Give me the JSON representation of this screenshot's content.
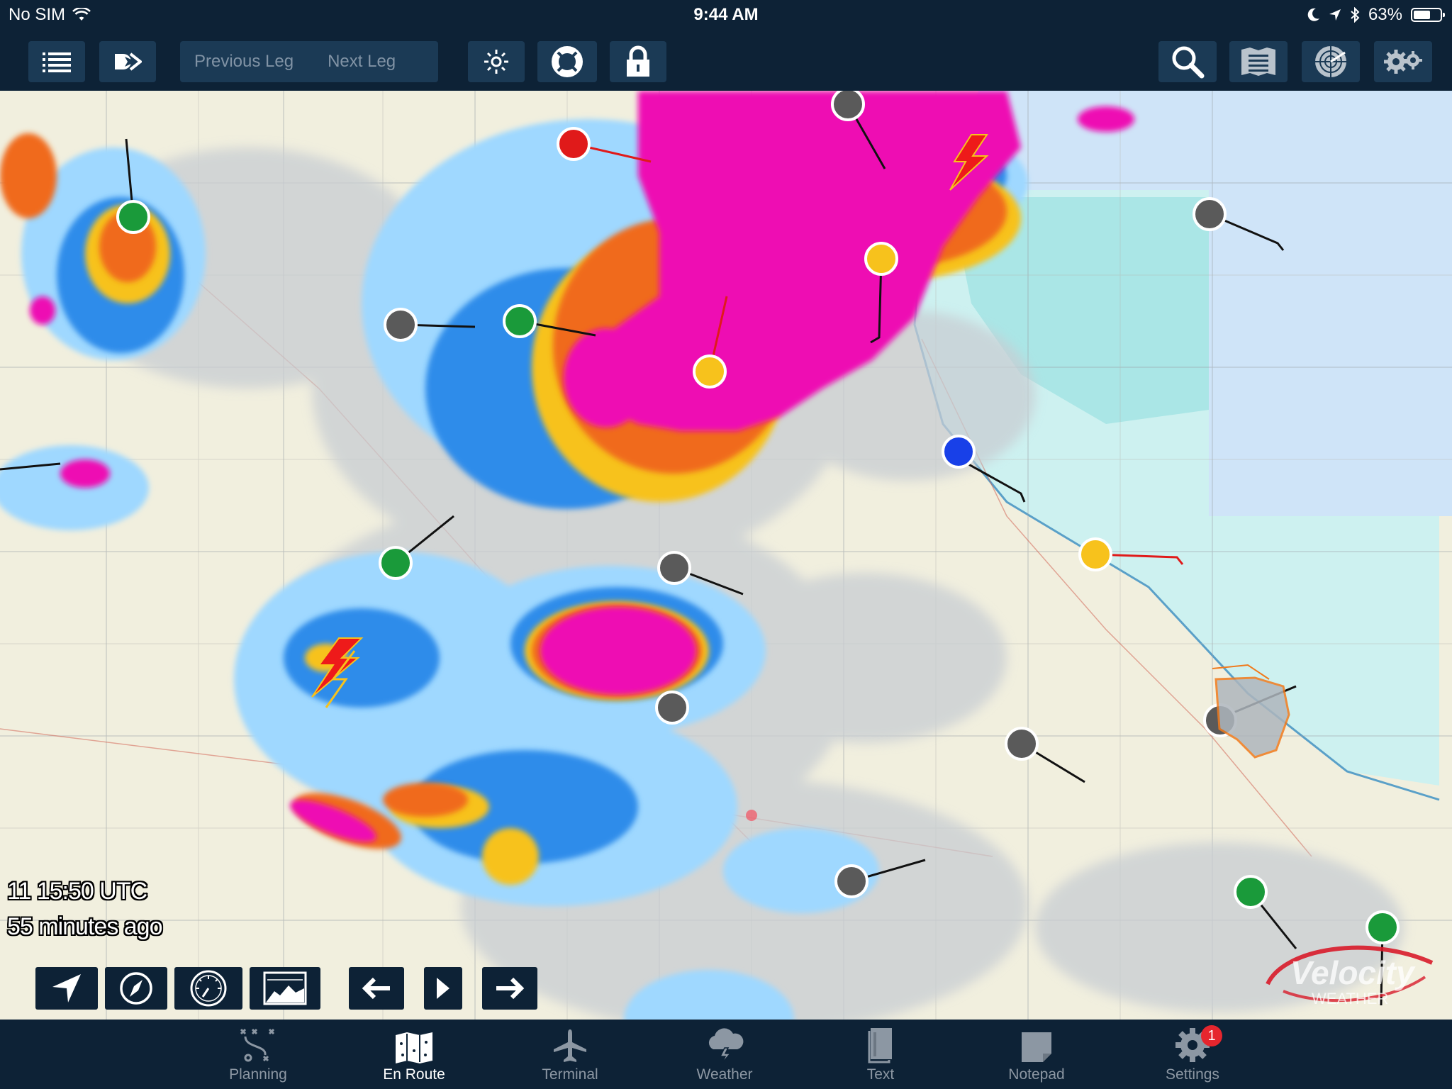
{
  "status_bar": {
    "carrier": "No SIM",
    "time": "9:44 AM",
    "battery": "63%",
    "battery_level": 0.63
  },
  "toolbar": {
    "previous_leg": "Previous Leg",
    "next_leg": "Next Leg",
    "icons": [
      "list-icon",
      "direct-to-icon",
      "brightness-icon",
      "lifebuoy-icon",
      "lock-icon",
      "search-icon",
      "layers-icon",
      "radar-icon",
      "settings-gears-icon"
    ]
  },
  "map": {
    "timestamp_line1": "11 15:50 UTC",
    "timestamp_line2": "55 minutes ago",
    "watermark": "Velocity WEATHER",
    "radar_colors": {
      "light": "#9fd8ff",
      "moderate": "#2f8cea",
      "heavy": "#f7c21c",
      "intense": "#f06a1c",
      "extreme": "#ee0fb3"
    },
    "marker_colors": {
      "gray": "#5a5a5a",
      "green": "#1a9a3a",
      "yellow": "#f7c21c",
      "red": "#e01a1a",
      "blue": "#1840e8"
    }
  },
  "map_controls": [
    "location-arrow-icon",
    "compass-icon",
    "speedometer-icon",
    "profile-chart-icon",
    "back-arrow-icon",
    "play-icon",
    "forward-arrow-icon"
  ],
  "tabs": [
    {
      "label": "Planning",
      "icon": "planning-icon"
    },
    {
      "label": "En Route",
      "icon": "map-icon",
      "active": true
    },
    {
      "label": "Terminal",
      "icon": "airplane-icon"
    },
    {
      "label": "Weather",
      "icon": "weather-cloud-icon"
    },
    {
      "label": "Text",
      "icon": "book-icon"
    },
    {
      "label": "Notepad",
      "icon": "notepad-icon"
    },
    {
      "label": "Settings",
      "icon": "settings-icon",
      "badge": "1"
    }
  ]
}
